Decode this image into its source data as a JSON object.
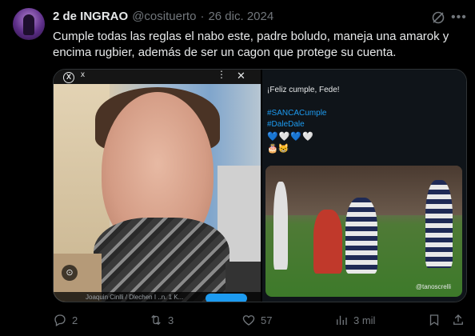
{
  "tweet": {
    "display_name": "2 de INGRAO",
    "handle": "@cosituerto",
    "separator": "·",
    "date": "26 dic. 2024",
    "text": "Cumple todas las reglas el nabo este, padre boludo, maneja una amarok y encima rugbier, además de ser un cagon que protege su cuenta."
  },
  "media": {
    "left": {
      "topbar_x": "x",
      "topbar_dots": "⋮",
      "topbar_close": "✕",
      "caption": "Joaquin Cinlli / Dlechen I ..n. 1 K..."
    },
    "right": {
      "line1": "¡Feliz cumple, Fede!",
      "hashtag1": "#SANCACumple",
      "hashtag2": "#DaleDale",
      "hearts": "💙🤍💙🤍",
      "emojis": "🎂😸",
      "photo_credit": "@tanoscrelli"
    }
  },
  "actions": {
    "replies": "2",
    "retweets": "3",
    "likes": "57",
    "views": "3 mil"
  },
  "colors": {
    "background": "#000000",
    "text": "#e7e9ea",
    "muted": "#71767b",
    "accent": "#1d9bf0"
  }
}
